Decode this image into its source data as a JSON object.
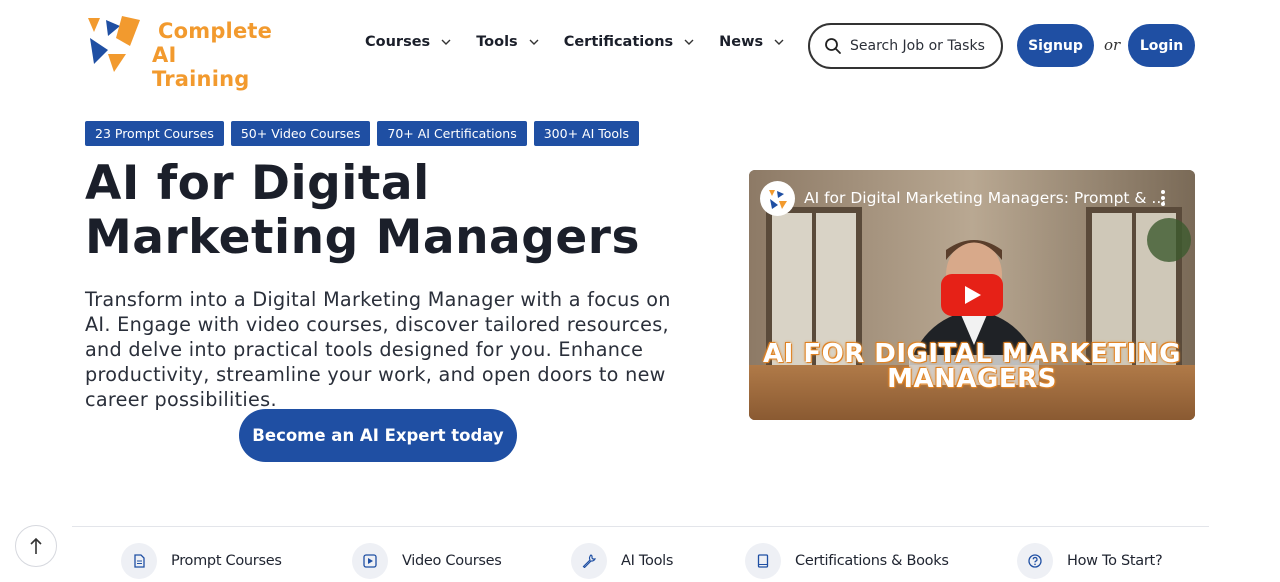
{
  "brand": {
    "name_line1": "Complete",
    "name_line2": "AI Training",
    "colors": {
      "orange": "#f29a2e",
      "blue": "#1f4fa3"
    }
  },
  "nav": {
    "items": [
      {
        "label": "Courses",
        "icon": "chevron-down-icon"
      },
      {
        "label": "Tools",
        "icon": "chevron-down-icon"
      },
      {
        "label": "Certifications",
        "icon": "chevron-down-icon"
      },
      {
        "label": "News",
        "icon": "chevron-down-icon"
      }
    ]
  },
  "search": {
    "placeholder": "Search Job or Tasks",
    "icon": "search-icon"
  },
  "auth": {
    "signup_label": "Signup",
    "or_label": "or",
    "login_label": "Login"
  },
  "badges": [
    "23 Prompt Courses",
    "50+ Video Courses",
    "70+ AI Certifications",
    "300+ AI Tools"
  ],
  "hero": {
    "title": "AI for Digital Marketing Managers",
    "description": "Transform into a Digital Marketing Manager with a focus on AI. Engage with video courses, discover tailored resources, and delve into practical tools designed for you. Enhance productivity, streamline your work, and open doors to new career possibilities.",
    "cta_label": "Become an AI Expert today"
  },
  "video": {
    "title": "AI for Digital Marketing Managers: Prompt & ...",
    "caption_line1": "AI FOR DIGITAL MARKETING",
    "caption_line2": "MANAGERS",
    "caption_color": "#e58b2a"
  },
  "bottom_nav": {
    "items": [
      {
        "label": "Prompt Courses",
        "icon": "document-icon"
      },
      {
        "label": "Video Courses",
        "icon": "play-square-icon"
      },
      {
        "label": "AI Tools",
        "icon": "wrench-icon"
      },
      {
        "label": "Certifications & Books",
        "icon": "book-icon"
      },
      {
        "label": "How To Start?",
        "icon": "question-circle-icon"
      }
    ]
  },
  "scroll_top": {
    "icon": "arrow-up-icon"
  }
}
